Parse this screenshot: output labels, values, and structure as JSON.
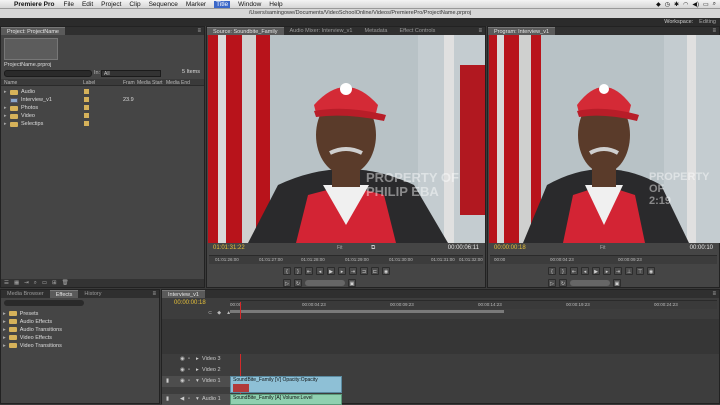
{
  "menubar": {
    "apple": "",
    "app": "Premiere Pro",
    "items": [
      "File",
      "Edit",
      "Project",
      "Clip",
      "Sequence",
      "Marker",
      "Title",
      "Window",
      "Help"
    ],
    "active_item": "Title",
    "status": [
      "",
      "",
      "",
      "",
      "",
      "",
      ""
    ]
  },
  "window": {
    "title": "/Users/samingowe/Documents/VideoSchoolOnline/Videos/PremierePro/ProjectName.prproj"
  },
  "workspace": {
    "label": "Workspace:",
    "value": "Editing"
  },
  "project": {
    "tab": "Project: ProjectName",
    "file_name": "ProjectName.prproj",
    "item_count": "5 Items",
    "in_label": "In:",
    "in_value": "All",
    "columns": {
      "name": "Name",
      "label": "Label",
      "frame_rate": "Fram",
      "media_start": "Media Start",
      "media_end": "Media End"
    },
    "rows": [
      {
        "name": "Audio",
        "type": "folder",
        "label_color": "#d6b25a",
        "fps": ""
      },
      {
        "name": "Interview_v1",
        "type": "sequence",
        "label_color": "#d6b25a",
        "fps": "23.9"
      },
      {
        "name": "Photos",
        "type": "folder",
        "label_color": "#d6b25a",
        "fps": ""
      },
      {
        "name": "Video",
        "type": "folder",
        "label_color": "#d6b25a",
        "fps": ""
      },
      {
        "name": "Selectips",
        "type": "folder",
        "label_color": "#d6b25a",
        "fps": ""
      }
    ]
  },
  "source": {
    "tabs": [
      "Source: Soundbite_Family",
      "Audio Mixer: Interview_v1",
      "Metadata",
      "Effect Controls"
    ],
    "timecode_in": "01:01:31:22",
    "fit": "Fit",
    "timecode_dur": "00:00:06:11",
    "ruler": [
      "01:01:26:00",
      "01:01:27:00",
      "01:01:28:00",
      "01:01:29:00",
      "01:01:30:00",
      "01:01:31:00",
      "01:01:32:00"
    ]
  },
  "program": {
    "tab": "Program: Interview_v1",
    "timecode_in": "00:00:00:18",
    "fit": "Fit",
    "timecode_dur": "00:00:10",
    "ruler": [
      "00:00",
      "00:00:04:23",
      "00:00:09:23"
    ]
  },
  "watermark": {
    "line1": "PROPERTY OF",
    "line2": "PHILIP EBA",
    "code": "2:19"
  },
  "effects": {
    "tabs": [
      "Media Browser",
      "Effects",
      "History"
    ],
    "active_tab": "Effects",
    "folders": [
      "Presets",
      "Audio Effects",
      "Audio Transitions",
      "Video Effects",
      "Video Transitions"
    ]
  },
  "timeline": {
    "tab": "Interview_v1",
    "timecode": "00:00:00:18",
    "ruler": [
      "00:00",
      "00:00:04:23",
      "00:00:09:23",
      "00:00:14:23",
      "00:00:19:23",
      "00:00:24:23"
    ],
    "tracks": [
      "Video 3",
      "Video 2",
      "Video 1",
      "Audio 1"
    ],
    "video_clip": "SoundBite_Family [V] Opacity:Opacity",
    "audio_clip": "SoundBite_Family [A] Volume:Level"
  },
  "colors": {
    "accent_timecode": "#e8c23a",
    "clip_video": "#8ec0d6",
    "clip_audio": "#8fd0b0",
    "folder": "#d6b25a"
  }
}
